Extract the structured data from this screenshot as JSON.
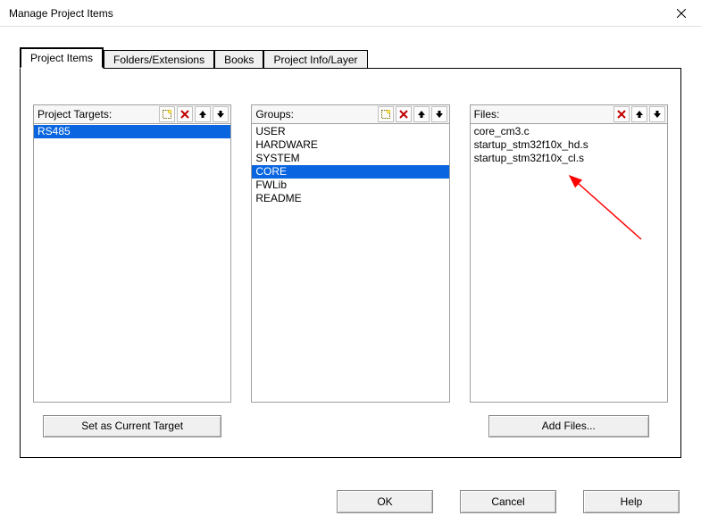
{
  "window": {
    "title": "Manage Project Items"
  },
  "tabs": [
    {
      "label": "Project Items",
      "active": true
    },
    {
      "label": "Folders/Extensions",
      "active": false
    },
    {
      "label": "Books",
      "active": false
    },
    {
      "label": "Project Info/Layer",
      "active": false
    }
  ],
  "icons": {
    "new": "new-icon",
    "delete": "delete-icon",
    "up": "arrow-up-icon",
    "down": "arrow-down-icon"
  },
  "targets": {
    "header": "Project Targets:",
    "items": [
      {
        "label": "RS485",
        "selected": true
      }
    ],
    "button": "Set as Current Target"
  },
  "groups": {
    "header": "Groups:",
    "items": [
      {
        "label": "USER",
        "selected": false
      },
      {
        "label": "HARDWARE",
        "selected": false
      },
      {
        "label": "SYSTEM",
        "selected": false
      },
      {
        "label": "CORE",
        "selected": true
      },
      {
        "label": "FWLib",
        "selected": false
      },
      {
        "label": "README",
        "selected": false
      }
    ]
  },
  "files": {
    "header": "Files:",
    "items": [
      {
        "label": "core_cm3.c",
        "selected": false
      },
      {
        "label": "startup_stm32f10x_hd.s",
        "selected": false
      },
      {
        "label": "startup_stm32f10x_cl.s",
        "selected": false
      }
    ],
    "button": "Add Files..."
  },
  "buttons": {
    "ok": "OK",
    "cancel": "Cancel",
    "help": "Help"
  }
}
